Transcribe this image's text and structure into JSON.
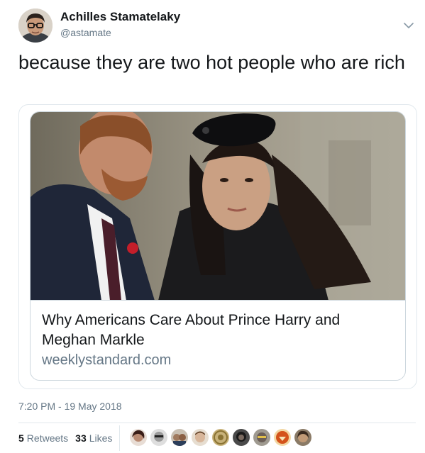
{
  "author": {
    "display_name": "Achilles Stamatelaky",
    "handle": "@astamate",
    "avatar_icon": "profile-avatar"
  },
  "tweet": {
    "text": "because they are two hot people who are rich"
  },
  "card": {
    "title": "Why Americans Care About Prince Harry and Meghan Markle",
    "domain": "weeklystandard.com",
    "image_icon": "article-photo"
  },
  "meta": {
    "timestamp": "7:20 PM - 19 May 2018"
  },
  "stats": {
    "retweets_count": "5",
    "retweets_label": "Retweets",
    "likes_count": "33",
    "likes_label": "Likes"
  },
  "likers": [
    {
      "icon": "liker-avatar-1",
      "color": "#5a3a35"
    },
    {
      "icon": "liker-avatar-2",
      "color": "#6d6d6d"
    },
    {
      "icon": "liker-avatar-3",
      "color": "#8a6a4e"
    },
    {
      "icon": "liker-avatar-4",
      "color": "#c6b09a"
    },
    {
      "icon": "liker-avatar-5",
      "color": "#b89c5a"
    },
    {
      "icon": "liker-avatar-6",
      "color": "#2b2b2b"
    },
    {
      "icon": "liker-avatar-7",
      "color": "#7a6f6a"
    },
    {
      "icon": "liker-avatar-8",
      "color": "#d4531b"
    },
    {
      "icon": "liker-avatar-9",
      "color": "#4d3a2b"
    }
  ],
  "colors": {
    "text": "#14171a",
    "secondary": "#657786",
    "border": "#e1e8ed"
  }
}
